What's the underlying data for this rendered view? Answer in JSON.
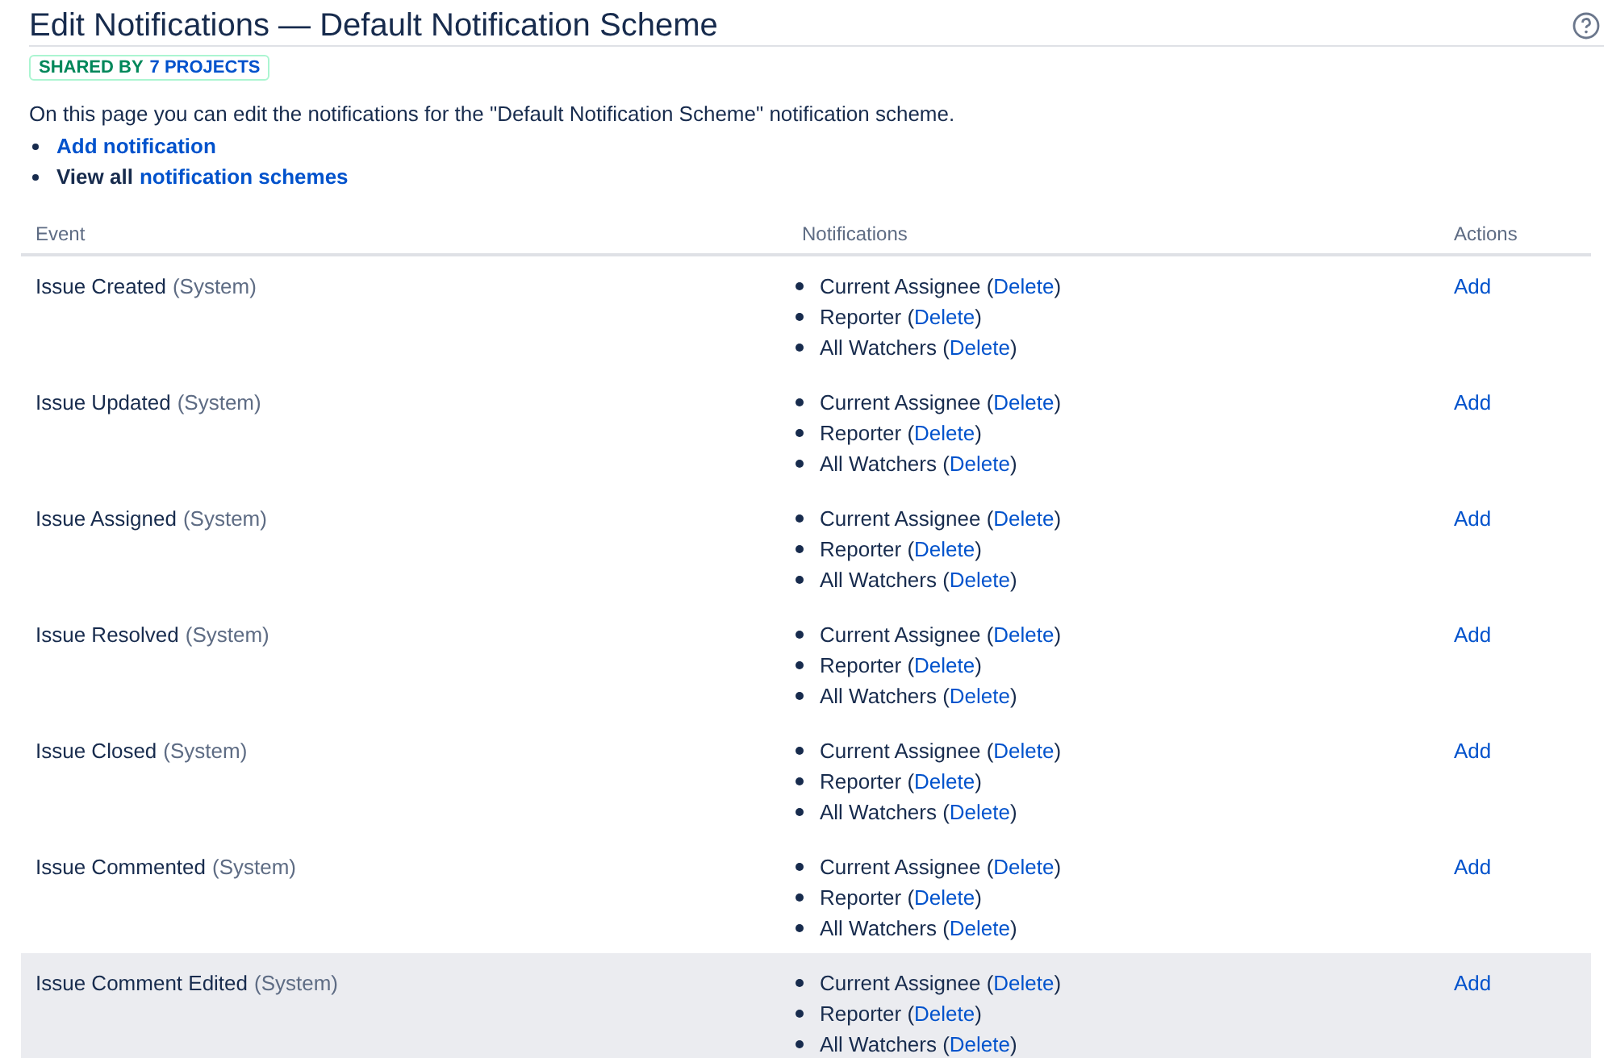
{
  "title": "Edit Notifications — Default Notification Scheme",
  "badge": {
    "shared": "SHARED BY",
    "projects": "7 PROJECTS"
  },
  "intro": "On this page you can edit the notifications for the \"Default Notification Scheme\" notification scheme.",
  "links": [
    {
      "link": "Add notification"
    },
    {
      "prefix": "View all",
      "link": "notification schemes"
    }
  ],
  "columns": [
    "Event",
    "Notifications",
    "Actions"
  ],
  "rows": [
    {
      "event": "Issue Created",
      "tag": "(System)",
      "highlighted": false,
      "action": "Add",
      "notifications": [
        {
          "prefix": "Current Assignee (",
          "link": "Delete",
          "suffix": ")"
        },
        {
          "prefix": "Reporter (",
          "link": "Delete",
          "suffix": ")"
        },
        {
          "prefix": "All Watchers (",
          "link": "Delete",
          "suffix": ")"
        }
      ]
    },
    {
      "event": "Issue Updated",
      "tag": "(System)",
      "highlighted": false,
      "action": "Add",
      "notifications": [
        {
          "prefix": "Current Assignee (",
          "link": "Delete",
          "suffix": ")"
        },
        {
          "prefix": "Reporter (",
          "link": "Delete",
          "suffix": ")"
        },
        {
          "prefix": "All Watchers (",
          "link": "Delete",
          "suffix": ")"
        }
      ]
    },
    {
      "event": "Issue Assigned",
      "tag": "(System)",
      "highlighted": false,
      "action": "Add",
      "notifications": [
        {
          "prefix": "Current Assignee (",
          "link": "Delete",
          "suffix": ")"
        },
        {
          "prefix": "Reporter (",
          "link": "Delete",
          "suffix": ")"
        },
        {
          "prefix": "All Watchers (",
          "link": "Delete",
          "suffix": ")"
        }
      ]
    },
    {
      "event": "Issue Resolved",
      "tag": "(System)",
      "highlighted": false,
      "action": "Add",
      "notifications": [
        {
          "prefix": "Current Assignee (",
          "link": "Delete",
          "suffix": ")"
        },
        {
          "prefix": "Reporter (",
          "link": "Delete",
          "suffix": ")"
        },
        {
          "prefix": "All Watchers (",
          "link": "Delete",
          "suffix": ")"
        }
      ]
    },
    {
      "event": "Issue Closed",
      "tag": "(System)",
      "highlighted": false,
      "action": "Add",
      "notifications": [
        {
          "prefix": "Current Assignee (",
          "link": "Delete",
          "suffix": ")"
        },
        {
          "prefix": "Reporter (",
          "link": "Delete",
          "suffix": ")"
        },
        {
          "prefix": "All Watchers (",
          "link": "Delete",
          "suffix": ")"
        }
      ]
    },
    {
      "event": "Issue Commented",
      "tag": "(System)",
      "highlighted": false,
      "action": "Add",
      "notifications": [
        {
          "prefix": "Current Assignee (",
          "link": "Delete",
          "suffix": ")"
        },
        {
          "prefix": "Reporter (",
          "link": "Delete",
          "suffix": ")"
        },
        {
          "prefix": "All Watchers (",
          "link": "Delete",
          "suffix": ")"
        }
      ]
    },
    {
      "event": "Issue Comment Edited",
      "tag": "(System)",
      "highlighted": true,
      "action": "Add",
      "notifications": [
        {
          "prefix": "Current Assignee (",
          "link": "Delete",
          "suffix": ")"
        },
        {
          "prefix": "Reporter (",
          "link": "Delete",
          "suffix": ")"
        },
        {
          "prefix": "All Watchers (",
          "link": "Delete",
          "suffix": ")"
        }
      ]
    }
  ]
}
